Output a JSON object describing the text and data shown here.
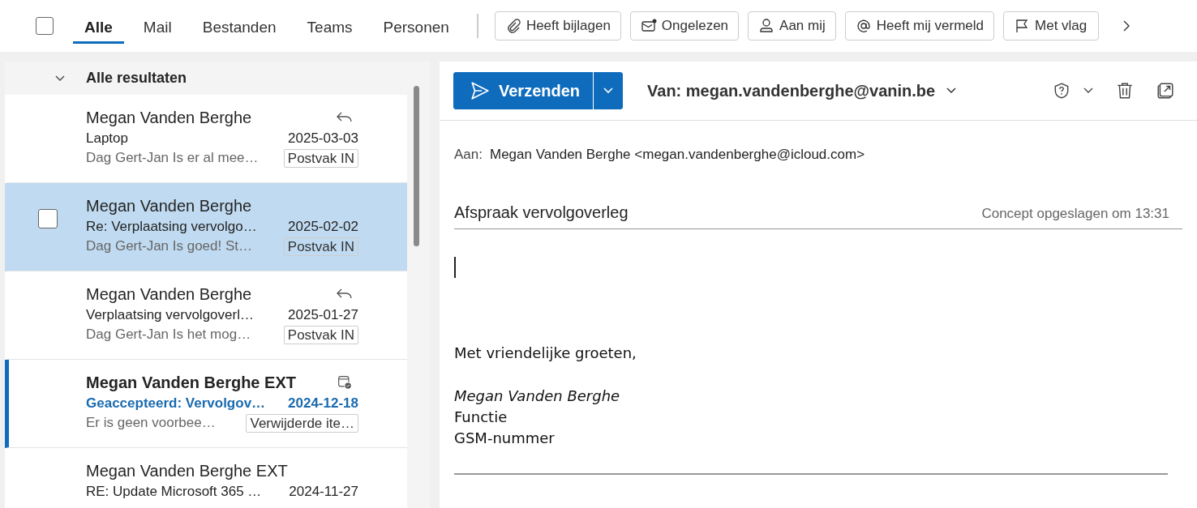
{
  "select_all": {
    "checked": false
  },
  "tabs": [
    {
      "label": "Alle",
      "selected": true
    },
    {
      "label": "Mail",
      "selected": false
    },
    {
      "label": "Bestanden",
      "selected": false
    },
    {
      "label": "Teams",
      "selected": false
    },
    {
      "label": "Personen",
      "selected": false
    }
  ],
  "filters": [
    {
      "label": "Heeft bijlagen",
      "kind": "attachment"
    },
    {
      "label": "Ongelezen",
      "kind": "unread"
    },
    {
      "label": "Aan mij",
      "kind": "person"
    },
    {
      "label": "Heeft mij vermeld",
      "kind": "mention"
    },
    {
      "label": "Met vlag",
      "kind": "flag"
    }
  ],
  "results": {
    "header": "Alle resultaten",
    "expanded": true,
    "messages": [
      {
        "sender": "Megan Vanden Berghe",
        "subject": "Laptop",
        "date": "2025-03-03",
        "preview": "Dag Gert-Jan Is er al mee…",
        "folder": "Postvak IN",
        "kind": "replied",
        "selected": false,
        "unread": false
      },
      {
        "sender": "Megan Vanden Berghe",
        "subject": "Re: Verplaatsing vervolgo…",
        "date": "2025-02-02",
        "preview": "Dag Gert-Jan Is goed! St…",
        "folder": "Postvak IN",
        "kind": "plain",
        "selected": true,
        "unread": false
      },
      {
        "sender": "Megan Vanden Berghe",
        "subject": "Verplaatsing vervolgoverl…",
        "date": "2025-01-27",
        "preview": "Dag Gert-Jan Is het mog…",
        "folder": "Postvak IN",
        "kind": "replied",
        "selected": false,
        "unread": false
      },
      {
        "sender": "Megan Vanden Berghe EXT",
        "subject": "Geaccepteerd: Vervolgov…",
        "date": "2024-12-18",
        "preview": "Er is geen voorbee…",
        "folder": "Verwijderde ite…",
        "kind": "meeting",
        "selected": false,
        "unread": true
      },
      {
        "sender": "Megan Vanden Berghe EXT",
        "subject": "RE: Update Microsoft 365 …",
        "date": "2024-11-27",
        "kind": "plain",
        "selected": false,
        "unread": false
      }
    ]
  },
  "compose": {
    "send_label": "Verzenden",
    "from": "Van: megan.vandenberghe@vanin.be",
    "to_label": "Aan:",
    "to": "Megan Vanden Berghe <megan.vandenberghe@icloud.com>",
    "subject": "Afspraak vervolgoverleg",
    "saved": "Concept opgeslagen om 13:31",
    "closing": "Met vriendelijke groeten,",
    "signature": [
      {
        "text": "Megan Vanden Berghe",
        "kind": "italic"
      },
      {
        "text": "Functie",
        "kind": "plain"
      },
      {
        "text": "GSM-nummer",
        "kind": "plain"
      }
    ]
  }
}
